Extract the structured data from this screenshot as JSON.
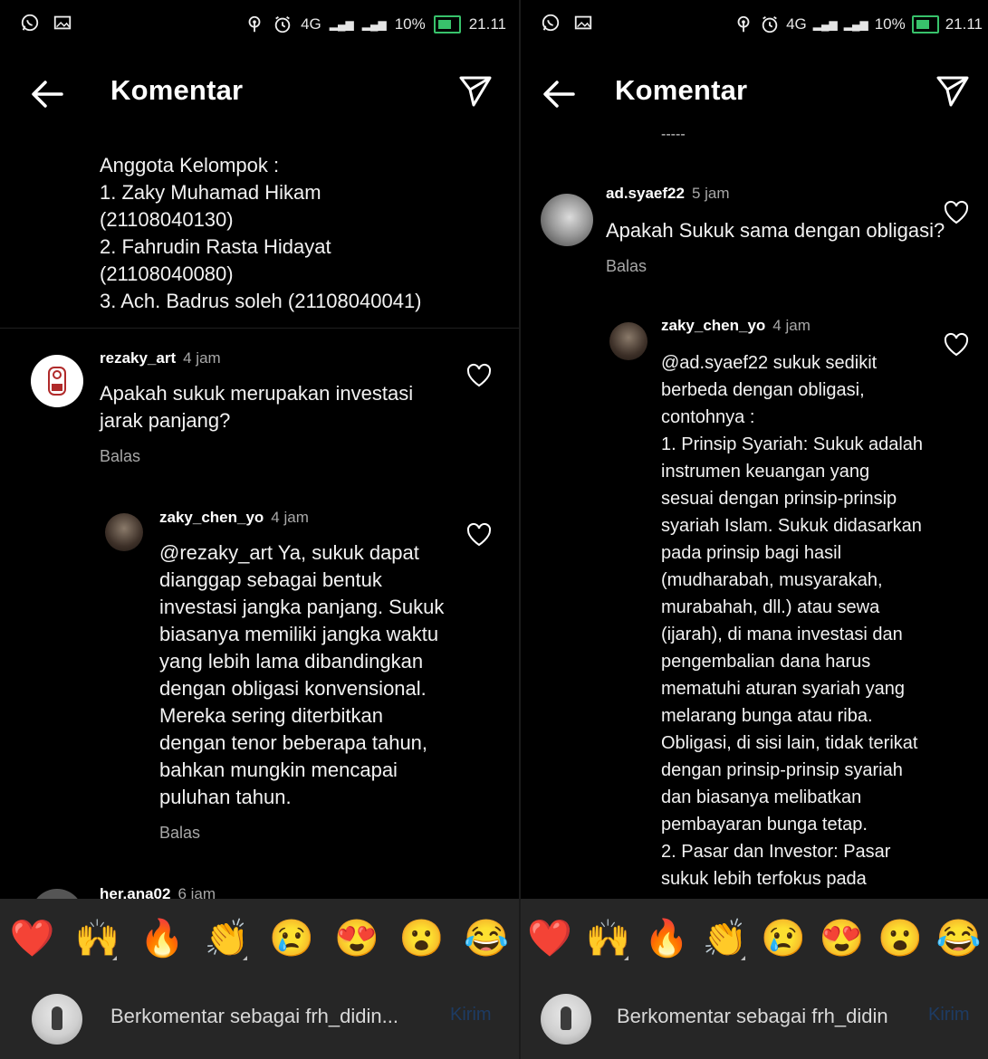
{
  "status_bar": {
    "time": "21.11",
    "battery": "10%",
    "network": "4G"
  },
  "left": {
    "header": {
      "title": "Komentar"
    },
    "caption_lines": "Anggota Kelompok :\n1. Zaky Muhamad Hikam\n(21108040130)\n2. Fahrudin Rasta Hidayat\n(21108040080)\n3. Ach. Badrus soleh (21108040041)",
    "comment1": {
      "username": "rezaky_art",
      "time": "4 jam",
      "text": "Apakah sukuk merupakan investasi\njarak panjang?",
      "reply": "Balas"
    },
    "reply1": {
      "username": "zaky_chen_yo",
      "time": "4 jam",
      "text": "@rezaky_art Ya, sukuk dapat\ndianggap sebagai bentuk\ninvestasi jangka panjang. Sukuk\nbiasanya memiliki jangka waktu\nyang lebih lama dibandingkan\ndengan obligasi konvensional.\nMereka sering diterbitkan\ndengan tenor beberapa tahun,\nbahkan mungkin mencapai\npuluhan tahun.",
      "reply": "Balas"
    },
    "partial_comment": {
      "username": "her.ana02",
      "time": "6 jam"
    },
    "compose": {
      "placeholder": "Berkomentar sebagai frh_didin...",
      "send": "Kirim"
    }
  },
  "right": {
    "header": {
      "title": "Komentar"
    },
    "partial_caption": "-----",
    "comment1": {
      "username": "ad.syaef22",
      "time": "5 jam",
      "text": "Apakah Sukuk sama dengan obligasi?",
      "reply": "Balas"
    },
    "reply1": {
      "username": "zaky_chen_yo",
      "time": "4 jam",
      "text": "@ad.syaef22 sukuk sedikit\nberbeda dengan obligasi,\ncontohnya :\n1. Prinsip Syariah: Sukuk adalah\ninstrumen keuangan yang\nsesuai dengan prinsip-prinsip\nsyariah Islam. Sukuk didasarkan\npada prinsip bagi hasil\n(mudharabah, musyarakah,\nmurabahah, dll.) atau sewa\n(ijarah), di mana investasi dan\npengembalian dana harus\nmematuhi aturan syariah yang\nmelarang bunga atau riba.\nObligasi, di sisi lain, tidak terikat\ndengan prinsip-prinsip syariah\ndan biasanya melibatkan\npembayaran bunga tetap.\n2. Pasar dan Investor: Pasar\nsukuk lebih terfokus pada"
    },
    "compose": {
      "placeholder": "Berkomentar sebagai frh_didin...",
      "send": "Kirim"
    }
  },
  "reactions": [
    "❤️",
    "🙌",
    "🔥",
    "👏",
    "😢",
    "😍",
    "😮",
    "😂"
  ],
  "colors": {
    "background": "#000000",
    "bar": "#262626",
    "muted_text": "#a8a8a8",
    "send_disabled": "#1d3b63",
    "heart_red": "#ed1c24"
  }
}
